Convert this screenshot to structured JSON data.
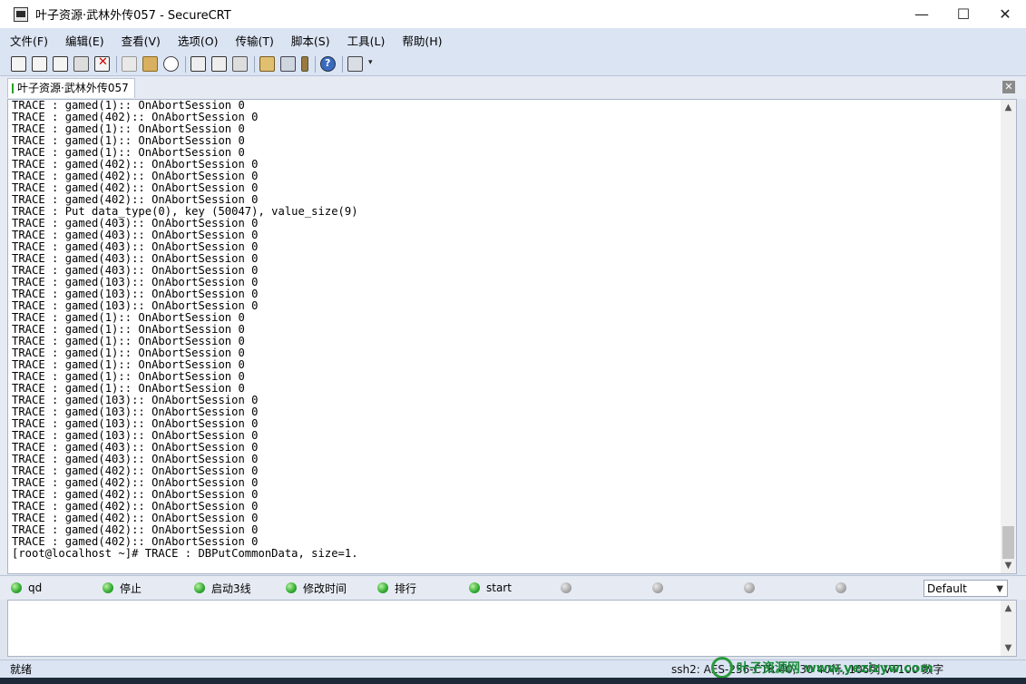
{
  "window": {
    "title": "叶子资源·武林外传057 - SecureCRT",
    "minimize": "—",
    "maximize": "☐",
    "close": "✕"
  },
  "menu": [
    "文件(F)",
    "编辑(E)",
    "查看(V)",
    "选项(O)",
    "传输(T)",
    "脚本(S)",
    "工具(L)",
    "帮助(H)"
  ],
  "toolbar": {
    "icons": [
      "connect-icon",
      "quick-connect-icon",
      "connect-tab-icon",
      "reconnect-icon",
      "disconnect-icon",
      "copy-icon",
      "paste-icon",
      "find-icon",
      "print-icon",
      "print-selection-icon",
      "print-setup-icon",
      "session-options-icon",
      "global-options-icon",
      "keymap-icon",
      "help-icon",
      "sftp-icon",
      "more-icon"
    ]
  },
  "tab": {
    "label": "叶子资源·武林外传057",
    "close": "✕"
  },
  "terminal": {
    "lines": [
      "TRACE : gamed(1):: OnAbortSession 0",
      "TRACE : gamed(402):: OnAbortSession 0",
      "TRACE : gamed(1):: OnAbortSession 0",
      "TRACE : gamed(1):: OnAbortSession 0",
      "TRACE : gamed(1):: OnAbortSession 0",
      "TRACE : gamed(402):: OnAbortSession 0",
      "TRACE : gamed(402):: OnAbortSession 0",
      "TRACE : gamed(402):: OnAbortSession 0",
      "TRACE : gamed(402):: OnAbortSession 0",
      "TRACE : Put data_type(0), key (50047), value_size(9)",
      "TRACE : gamed(403):: OnAbortSession 0",
      "TRACE : gamed(403):: OnAbortSession 0",
      "TRACE : gamed(403):: OnAbortSession 0",
      "TRACE : gamed(403):: OnAbortSession 0",
      "TRACE : gamed(403):: OnAbortSession 0",
      "TRACE : gamed(103):: OnAbortSession 0",
      "TRACE : gamed(103):: OnAbortSession 0",
      "TRACE : gamed(103):: OnAbortSession 0",
      "TRACE : gamed(1):: OnAbortSession 0",
      "TRACE : gamed(1):: OnAbortSession 0",
      "TRACE : gamed(1):: OnAbortSession 0",
      "TRACE : gamed(1):: OnAbortSession 0",
      "TRACE : gamed(1):: OnAbortSession 0",
      "TRACE : gamed(1):: OnAbortSession 0",
      "TRACE : gamed(1):: OnAbortSession 0",
      "TRACE : gamed(103):: OnAbortSession 0",
      "TRACE : gamed(103):: OnAbortSession 0",
      "TRACE : gamed(103):: OnAbortSession 0",
      "TRACE : gamed(103):: OnAbortSession 0",
      "TRACE : gamed(403):: OnAbortSession 0",
      "TRACE : gamed(403):: OnAbortSession 0",
      "TRACE : gamed(402):: OnAbortSession 0",
      "TRACE : gamed(402):: OnAbortSession 0",
      "TRACE : gamed(402):: OnAbortSession 0",
      "TRACE : gamed(402):: OnAbortSession 0",
      "TRACE : gamed(402):: OnAbortSession 0",
      "TRACE : gamed(402):: OnAbortSession 0",
      "TRACE : gamed(402):: OnAbortSession 0",
      "[root@localhost ~]# TRACE : DBPutCommonData, size=1."
    ]
  },
  "buttons": [
    {
      "label": "qd",
      "active": true
    },
    {
      "label": "停止",
      "active": true
    },
    {
      "label": "启动3线",
      "active": true
    },
    {
      "label": "修改时间",
      "active": true
    },
    {
      "label": "排行",
      "active": true
    },
    {
      "label": "start",
      "active": true
    },
    {
      "label": "",
      "active": false
    },
    {
      "label": "",
      "active": false
    },
    {
      "label": "",
      "active": false
    },
    {
      "label": "",
      "active": false
    }
  ],
  "button_select": {
    "value": "Default"
  },
  "status": {
    "left": "就绪",
    "right": "ssh2: AES-256-CTR   40, 30  40行, 106列  VT100   数字"
  },
  "watermark": "叶子资源网 www.yezizyw.com"
}
